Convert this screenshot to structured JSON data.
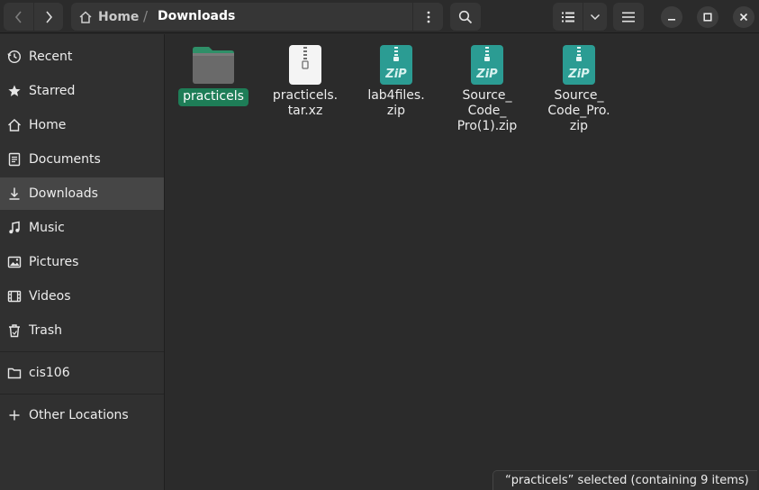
{
  "header": {
    "back_icon": "chevron-left-icon",
    "forward_icon": "chevron-right-icon",
    "path_home": "Home",
    "path_separator": "/",
    "path_current": "Downloads",
    "path_menu_icon": "vertical-ellipsis-icon",
    "search_icon": "search-icon",
    "view_icon": "list-view-icon",
    "view_dropdown_icon": "chevron-down-icon",
    "menu_icon": "hamburger-icon",
    "window_controls": [
      "minimize-icon",
      "maximize-icon",
      "close-icon"
    ]
  },
  "sidebar": {
    "items": [
      {
        "label": "Recent",
        "icon": "clock-icon"
      },
      {
        "label": "Starred",
        "icon": "star-icon"
      },
      {
        "label": "Home",
        "icon": "home-icon"
      },
      {
        "label": "Documents",
        "icon": "document-icon"
      },
      {
        "label": "Downloads",
        "icon": "download-icon",
        "active": true
      },
      {
        "label": "Music",
        "icon": "music-note-icon"
      },
      {
        "label": "Pictures",
        "icon": "picture-icon"
      },
      {
        "label": "Videos",
        "icon": "film-icon"
      },
      {
        "label": "Trash",
        "icon": "trash-icon"
      },
      {
        "label": "cis106",
        "icon": "folder-icon"
      },
      {
        "label": "Other Locations",
        "icon": "plus-icon"
      }
    ]
  },
  "files": [
    {
      "name": "practicels",
      "type": "folder",
      "selected": true
    },
    {
      "name": "practicels.\ntar.xz",
      "type": "archive"
    },
    {
      "name": "lab4files.\nzip",
      "type": "zip"
    },
    {
      "name": "Source_\nCode_\nPro(1).zip",
      "type": "zip"
    },
    {
      "name": "Source_\nCode_Pro.\nzip",
      "type": "zip"
    }
  ],
  "status": "“practicels” selected  (containing 9 items)",
  "colors": {
    "accent": "#1e7d57",
    "folder": "#4d9e7d",
    "zip": "#2b9c93",
    "window_bg": "#2b2b2b",
    "sidebar_bg": "#303030"
  }
}
